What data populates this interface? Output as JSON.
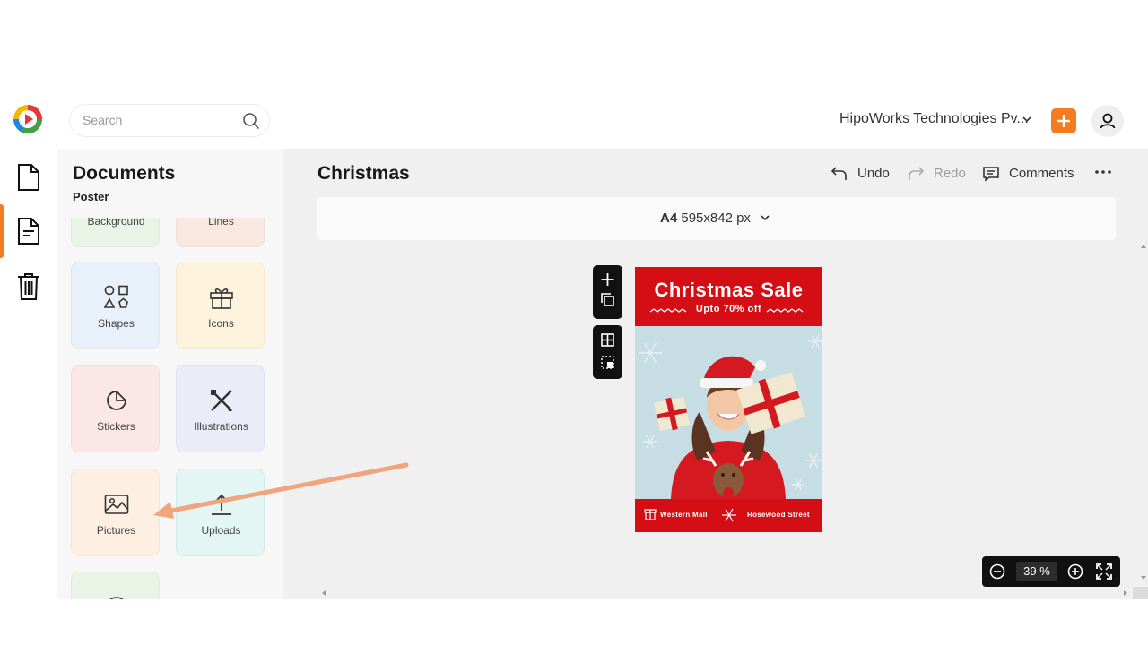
{
  "search": {
    "placeholder": "Search"
  },
  "header": {
    "org_name": "HipoWorks Technologies Pv..."
  },
  "panel": {
    "title": "Documents",
    "subtitle": "Poster",
    "tiles": [
      {
        "label": "Background"
      },
      {
        "label": "Lines"
      },
      {
        "label": "Shapes"
      },
      {
        "label": "Icons"
      },
      {
        "label": "Stickers"
      },
      {
        "label": "Illustrations"
      },
      {
        "label": "Pictures"
      },
      {
        "label": "Uploads"
      }
    ]
  },
  "editor": {
    "doc_title": "Christmas",
    "undo_label": "Undo",
    "redo_label": "Redo",
    "comments_label": "Comments",
    "page_size_name": "A4",
    "page_size_dims": "595x842 px",
    "zoom_value": "39",
    "zoom_unit": "%"
  },
  "poster": {
    "title": "Christmas Sale",
    "subtitle": "Upto 70% off",
    "footer_left": "Western Mall",
    "footer_right": "Rosewood Street"
  },
  "colors": {
    "accent": "#f47b20",
    "poster_red": "#d40e14",
    "arrow": "#f0a57c"
  }
}
